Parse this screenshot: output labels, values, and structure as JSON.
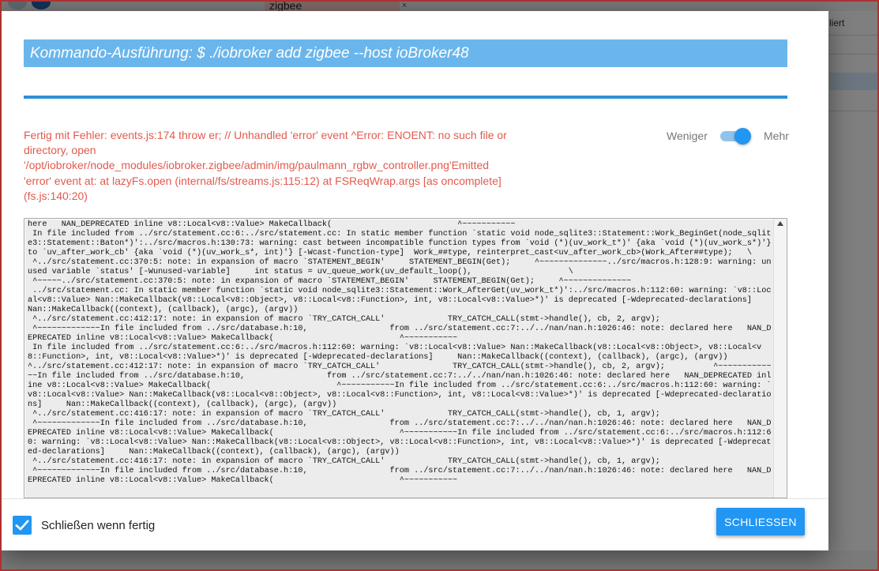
{
  "background": {
    "tab_label": "zigbee",
    "tab_close": "×",
    "right_label": "liert"
  },
  "dialog": {
    "title": "Kommando-Ausführung: $ ./iobroker add zigbee --host ioBroker48",
    "error_message": "Fertig mit Fehler: events.js:174 throw er; // Unhandled 'error' event ^Error: ENOENT: no such file or directory, open '/opt/iobroker/node_modules/iobroker.zigbee/admin/img/paulmann_rgbw_controller.png'Emitted 'error' event at: at lazyFs.open (internal/fs/streams.js:115:12) at FSReqWrap.args [as oncomplete] (fs.js:140:20)",
    "toggle": {
      "less_label": "Weniger",
      "more_label": "Mehr",
      "state": "Mehr"
    },
    "log": "here   NAN_DEPRECATED inline v8::Local<v8::Value> MakeCallback(                          ^~~~~~~~~~~~\n In file included from ../src/statement.cc:6:../src/statement.cc: In static member function `static void node_sqlite3::Statement::Work_BeginGet(node_sqlite3::Statement::Baton*)':../src/macros.h:130:73: warning: cast between incompatible function types from `void (*)(uv_work_t*)' {aka `void (*)(uv_work_s*)'} to `uv_after_work_cb' {aka `void (*)(uv_work_s*, int)'} [-Wcast-function-type]  Work_##type, reinterpret_cast<uv_after_work_cb>(Work_After##type);   \\\n ^../src/statement.cc:370:5: note: in expansion of macro `STATEMENT_BEGIN'     STATEMENT_BEGIN(Get);     ^~~~~~~~~~~~~~~../src/macros.h:128:9: warning: unused variable `status' [-Wunused-variable]     int status = uv_queue_work(uv_default_loop(),                    \\\n ^~~~~~../src/statement.cc:370:5: note: in expansion of macro `STATEMENT_BEGIN'     STATEMENT_BEGIN(Get);     ^~~~~~~~~~~~~~~\n ../src/statement.cc: In static member function `static void node_sqlite3::Statement::Work_AfterGet(uv_work_t*)':../src/macros.h:112:60: warning: `v8::Local<v8::Value> Nan::MakeCallback(v8::Local<v8::Object>, v8::Local<v8::Function>, int, v8::Local<v8::Value>*)' is deprecated [-Wdeprecated-declarations]     Nan::MakeCallback((context), (callback), (argc), (argv))\n ^../src/statement.cc:412:17: note: in expansion of macro `TRY_CATCH_CALL'             TRY_CATCH_CALL(stmt->handle(), cb, 2, argv);\n ^~~~~~~~~~~~~~In file included from ../src/database.h:10,                 from ../src/statement.cc:7:../../nan/nan.h:1026:46: note: declared here   NAN_DEPRECATED inline v8::Local<v8::Value> MakeCallback(                          ^~~~~~~~~~~~\n In file included from ../src/statement.cc:6:../src/macros.h:112:60: warning: `v8::Local<v8::Value> Nan::MakeCallback(v8::Local<v8::Object>, v8::Local<v8::Function>, int, v8::Local<v8::Value>*)' is deprecated [-Wdeprecated-declarations]     Nan::MakeCallback((context), (callback), (argc), (argv))                          ^../src/statement.cc:412:17: note: in expansion of macro `TRY_CATCH_CALL'               TRY_CATCH_CALL(stmt->handle(), cb, 2, argv);          ^~~~~~~~~~~~~~In file included from ../src/database.h:10,                 from ../src/statement.cc:7:../../nan/nan.h:1026:46: note: declared here   NAN_DEPRECATED inline v8::Local<v8::Value> MakeCallback(                          ^~~~~~~~~~~~In file included from ../src/statement.cc:6:../src/macros.h:112:60: warning: `v8::Local<v8::Value> Nan::MakeCallback(v8::Local<v8::Object>, v8::Local<v8::Function>, int, v8::Local<v8::Value>*)' is deprecated [-Wdeprecated-declarations]     Nan::MakeCallback((context), (callback), (argc), (argv))\n ^../src/statement.cc:416:17: note: in expansion of macro `TRY_CATCH_CALL'             TRY_CATCH_CALL(stmt->handle(), cb, 1, argv);\n ^~~~~~~~~~~~~~In file included from ../src/database.h:10,                 from ../src/statement.cc:7:../../nan/nan.h:1026:46: note: declared here   NAN_DEPRECATED inline v8::Local<v8::Value> MakeCallback(                          ^~~~~~~~~~~~In file included from ../src/statement.cc:6:../src/macros.h:112:60: warning: `v8::Local<v8::Value> Nan::MakeCallback(v8::Local<v8::Object>, v8::Local<v8::Function>, int, v8::Local<v8::Value>*)' is deprecated [-Wdeprecated-declarations]     Nan::MakeCallback((context), (callback), (argc), (argv))\n ^../src/statement.cc:416:17: note: in expansion of macro `TRY_CATCH_CALL'             TRY_CATCH_CALL(stmt->handle(), cb, 1, argv);\n ^~~~~~~~~~~~~~In file included from ../src/database.h:10,                 from ../src/statement.cc:7:../../nan/nan.h:1026:46: note: declared here   NAN_DEPRECATED inline v8::Local<v8::Value> MakeCallback(                          ^~~~~~~~~~~~",
    "close_when_done_label": "Schließen wenn fertig",
    "close_when_done_checked": true,
    "close_button_label": "SCHLIESSEN"
  },
  "colors": {
    "title_bar": "#6ab6ec",
    "accent": "#2196f3",
    "error_text": "#e25a4f"
  }
}
